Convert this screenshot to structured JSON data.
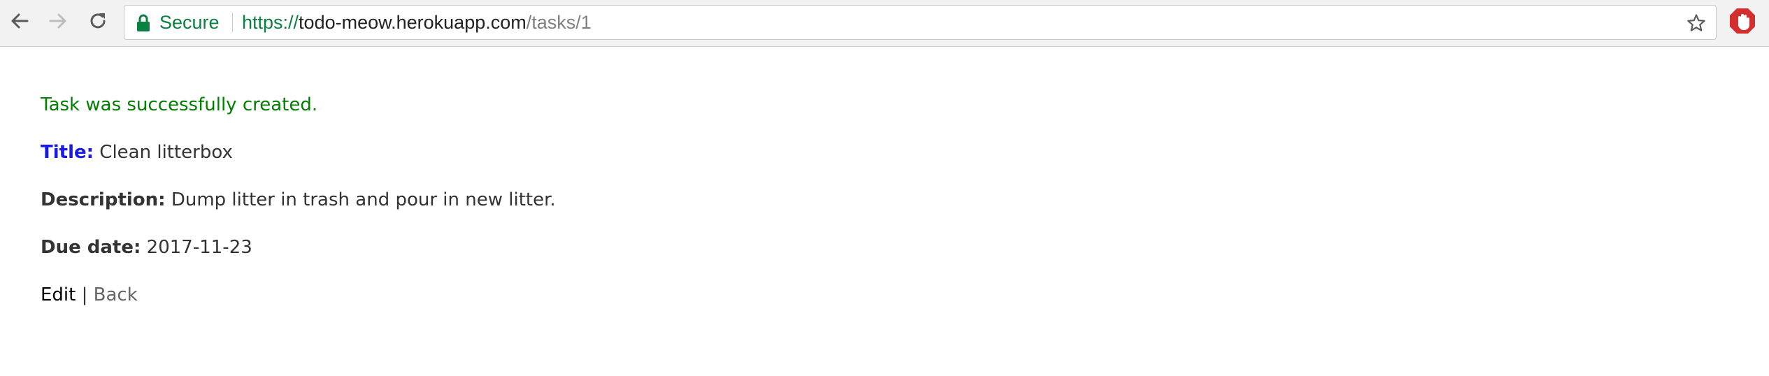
{
  "browser": {
    "secure_label": "Secure",
    "url": {
      "scheme": "https://",
      "host": "todo-meow.herokuapp.com",
      "path": "/tasks/1"
    },
    "icons": [
      "back-arrow-icon",
      "forward-arrow-icon",
      "reload-icon",
      "lock-icon",
      "star-icon",
      "extension-icon"
    ],
    "colors": {
      "secure_green": "#0b8043",
      "toolbar_bg": "#f2f2f2"
    }
  },
  "page": {
    "notice": "Task was successfully created.",
    "fields": {
      "title_label": "Title:",
      "title_value": "Clean litterbox",
      "description_label": "Description:",
      "description_value": "Dump litter in trash and pour in new litter.",
      "due_label": "Due date:",
      "due_value": "2017-11-23"
    },
    "links": {
      "edit": "Edit",
      "separator": "|",
      "back": "Back"
    },
    "colors": {
      "notice_green": "#008000",
      "title_label_blue": "#1a1ae6",
      "text": "#333333",
      "back_link": "#666666"
    }
  }
}
